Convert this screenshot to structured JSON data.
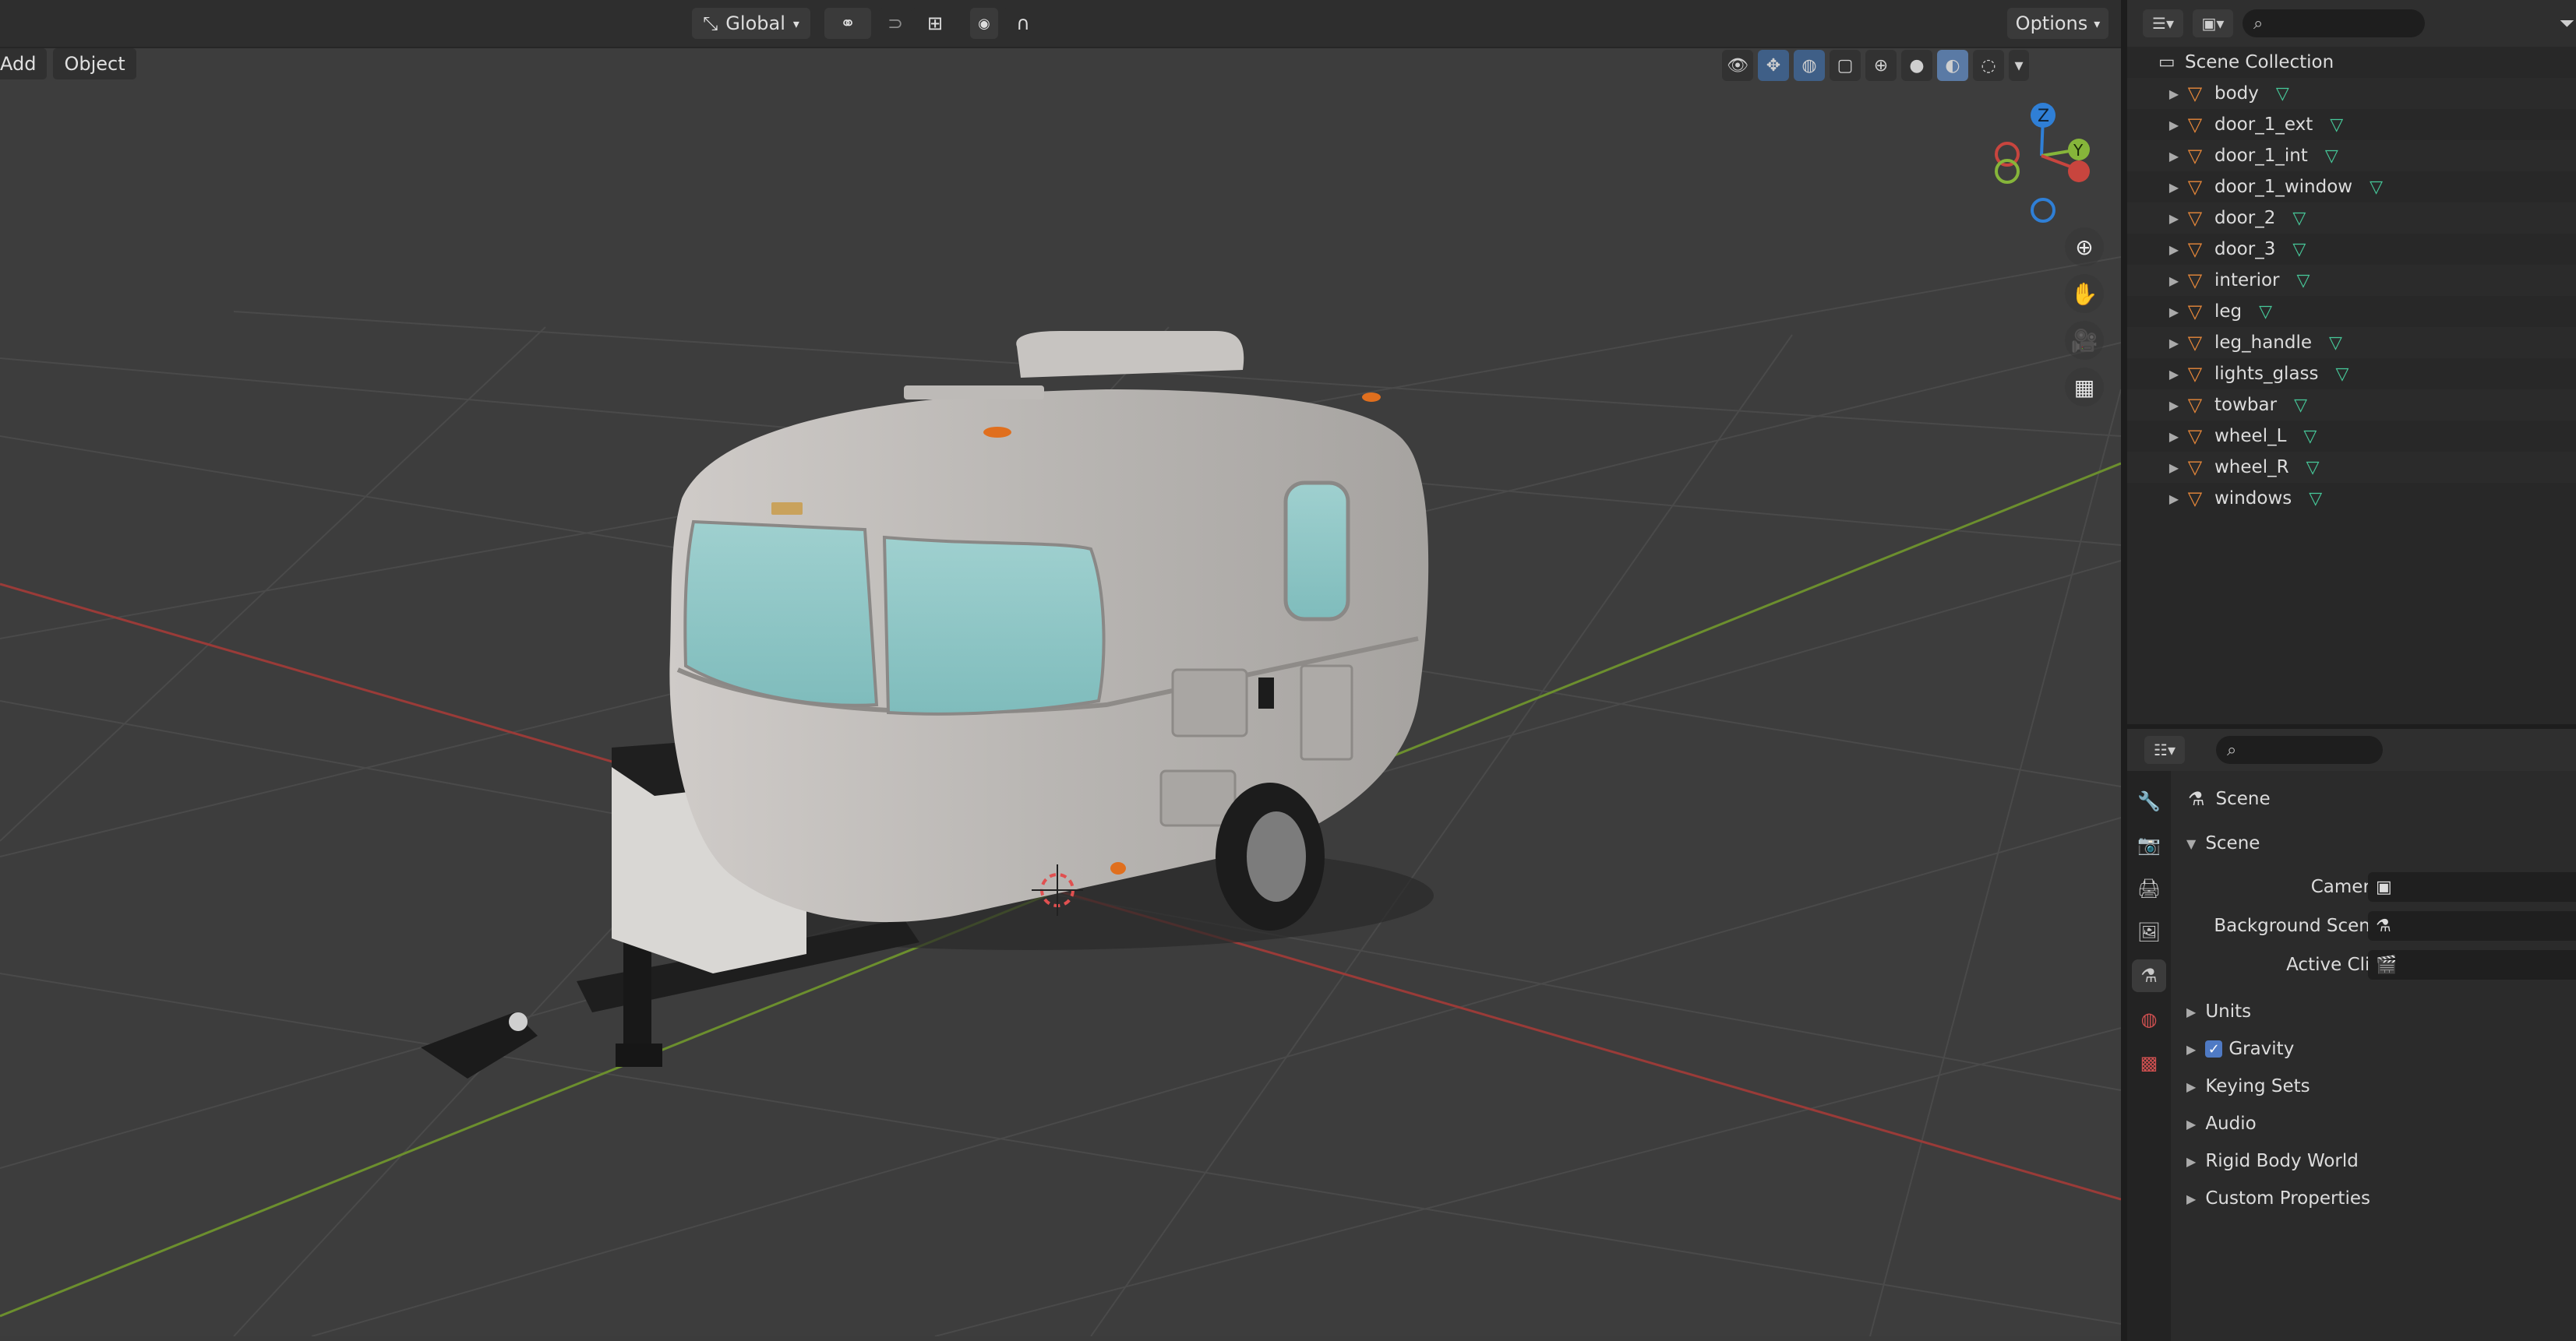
{
  "viewport": {
    "header": {
      "orientation_label": "Global",
      "options_label": "Options"
    },
    "menu": [
      "Add",
      "Object"
    ],
    "gizmo": {
      "z": "Z",
      "y": "Y"
    },
    "colors": {
      "x_axis": "#c8453e",
      "y_axis": "#86b53a",
      "z_axis": "#2f7fd6",
      "mesh_icon": "#47c99a",
      "object_icon": "#e8883a"
    }
  },
  "outliner": {
    "root_label": "Scene Collection",
    "items": [
      {
        "name": "body"
      },
      {
        "name": "door_1_ext"
      },
      {
        "name": "door_1_int"
      },
      {
        "name": "door_1_window"
      },
      {
        "name": "door_2"
      },
      {
        "name": "door_3"
      },
      {
        "name": "interior"
      },
      {
        "name": "leg"
      },
      {
        "name": "leg_handle"
      },
      {
        "name": "lights_glass"
      },
      {
        "name": "towbar"
      },
      {
        "name": "wheel_L"
      },
      {
        "name": "wheel_R"
      },
      {
        "name": "windows"
      }
    ]
  },
  "properties": {
    "context_label": "Scene",
    "panel_title": "Scene",
    "fields": [
      {
        "label": "Camera"
      },
      {
        "label": "Background Scene"
      },
      {
        "label": "Active Clip"
      }
    ],
    "subpanels": [
      {
        "label": "Units",
        "checkbox": false
      },
      {
        "label": "Gravity",
        "checkbox": true
      },
      {
        "label": "Keying Sets",
        "checkbox": false
      },
      {
        "label": "Audio",
        "checkbox": false
      },
      {
        "label": "Rigid Body World",
        "checkbox": false
      },
      {
        "label": "Custom Properties",
        "checkbox": false
      }
    ]
  }
}
